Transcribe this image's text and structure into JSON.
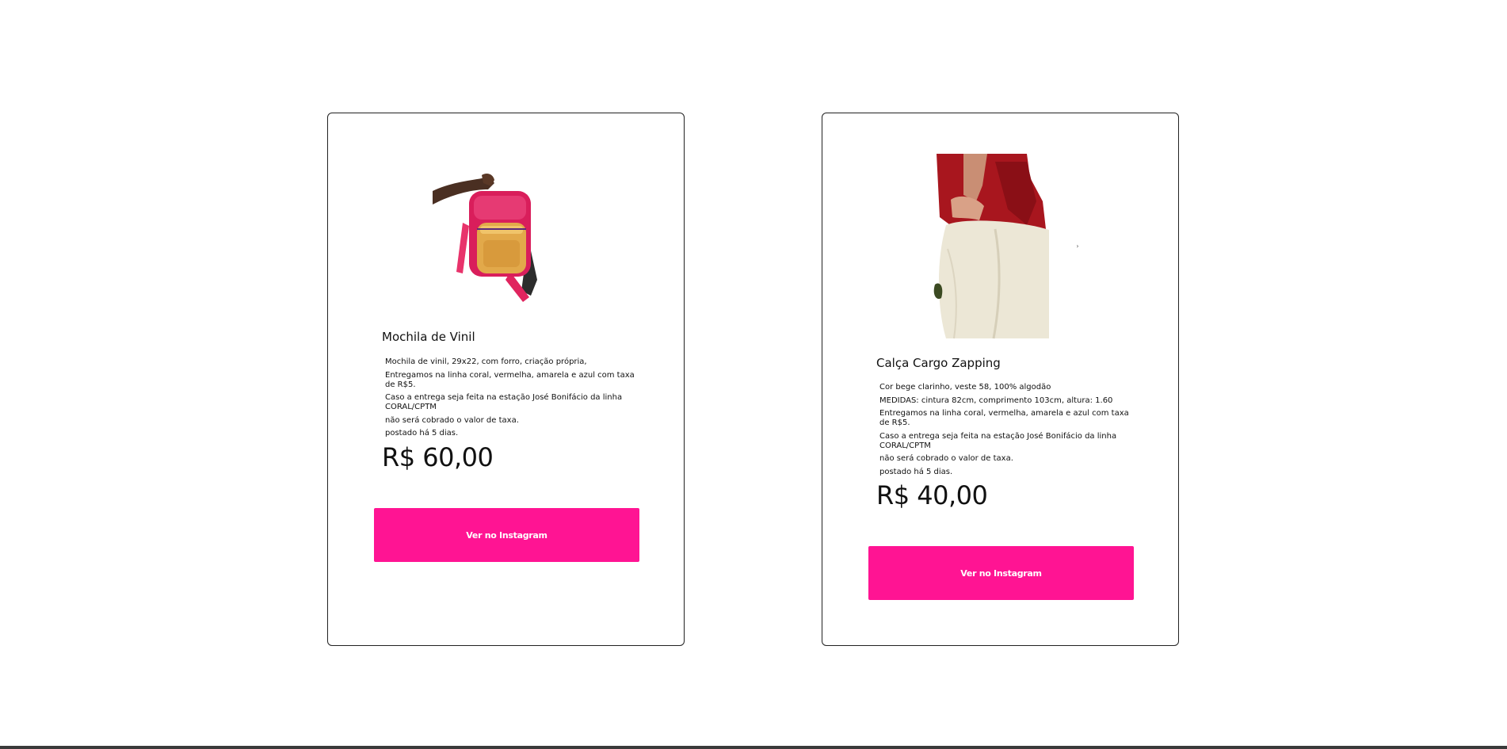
{
  "colors": {
    "accent": "#ff1493",
    "border": "#222222",
    "text": "#111111"
  },
  "products": [
    {
      "title": "Mochila de Vinil",
      "image_icon": "backpack-photo",
      "description": [
        "Mochila de vinil, 29x22, com forro, criação própria,",
        "Entregamos na linha coral, vermelha, amarela e azul com taxa de R$5.",
        "Caso a entrega seja feita na estação José Bonifácio da linha CORAL/CPTM",
        "não será cobrado o valor de taxa.",
        "postado há 5 dias."
      ],
      "price": "R$ 60,00",
      "button_label": "Ver no Instagram"
    },
    {
      "title": "Calça Cargo Zapping",
      "image_icon": "pants-photo",
      "description": [
        "Cor bege clarinho, veste 58, 100% algodão",
        "MEDIDAS: cintura 82cm, comprimento 103cm, altura: 1.60",
        "Entregamos na linha coral, vermelha, amarela e azul com taxa de R$5.",
        "Caso a entrega seja feita na estação José Bonifácio da linha CORAL/CPTM",
        "não será cobrado o valor de taxa.",
        "postado há 5 dias."
      ],
      "price": "R$ 40,00",
      "button_label": "Ver no Instagram"
    }
  ]
}
